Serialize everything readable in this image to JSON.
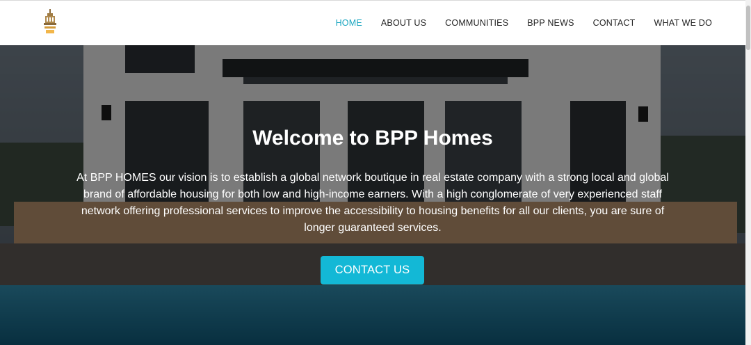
{
  "header": {
    "logo_icon": "bpp-homes-logo",
    "nav": [
      {
        "label": "HOME",
        "active": true
      },
      {
        "label": "ABOUT US",
        "active": false
      },
      {
        "label": "COMMUNITIES",
        "active": false
      },
      {
        "label": "BPP NEWS",
        "active": false
      },
      {
        "label": "CONTACT",
        "active": false
      },
      {
        "label": "WHAT WE DO",
        "active": false
      }
    ]
  },
  "hero": {
    "title": "Welcome to BPP Homes",
    "description": "At BPP HOMES our vision is to establish a global network boutique in real estate company with a strong local and global brand of affordable housing for both low and high-income earners. With a high conglomerate of very experienced staff network offering professional services to improve the accessibility to housing benefits for all our clients, you are sure of longer guaranteed services.",
    "cta_label": "CONTACT US",
    "background": "villa-with-pool-photo"
  },
  "colors": {
    "accent": "#13b8d6",
    "nav_active": "#1aa6c0",
    "nav_text": "#222222"
  }
}
